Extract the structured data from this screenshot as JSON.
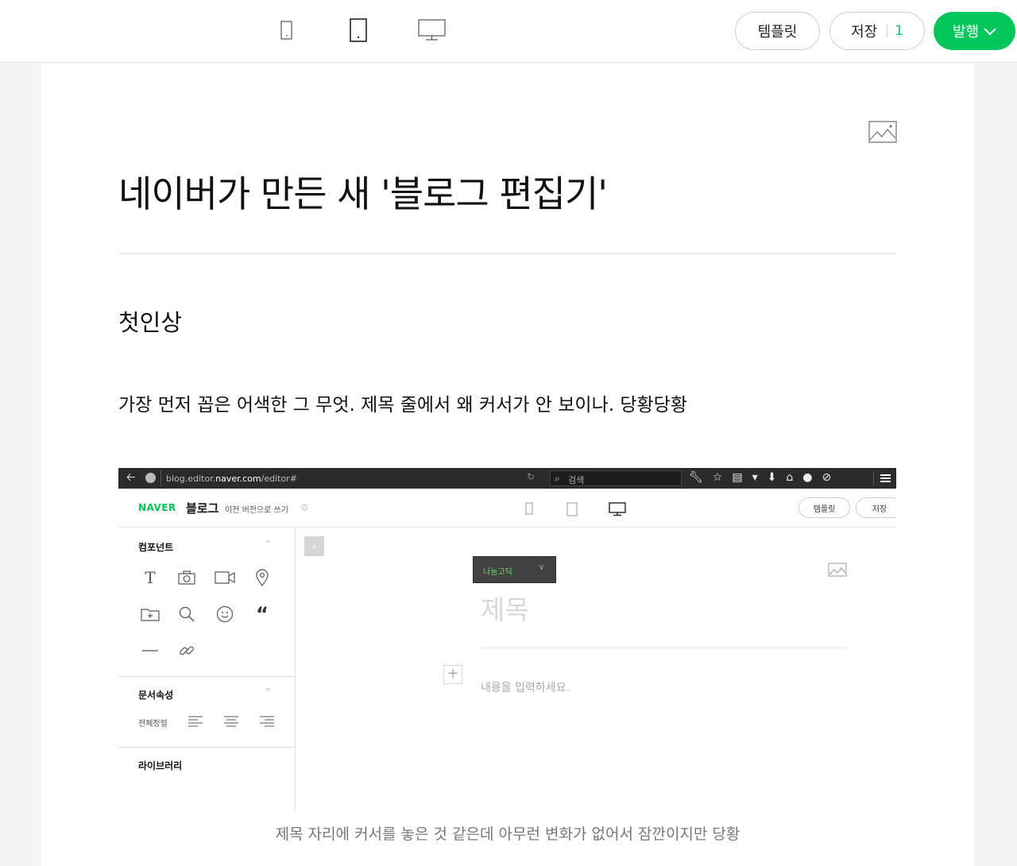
{
  "topbar": {
    "device_buttons": [
      "mobile",
      "tablet",
      "desktop"
    ],
    "template_label": "템플릿",
    "save_label": "저장",
    "save_count": "1",
    "publish_label": "발행",
    "accent_color": "#03c75a"
  },
  "post": {
    "title": "네이버가 만든 새 '블로그 편집기'",
    "heading": "첫인상",
    "paragraph": "가장 먼저 꼽은 어색한 그 무엇. 제목 줄에서 왜 커서가 안 보이나. 당황당황",
    "caption": "제목 자리에 커서를 놓은 것 같은데 아무런 변화가 없어서 잠깐이지만 당황"
  },
  "screenshot": {
    "browser": {
      "url_prefix": "blog.editor.",
      "url_domain": "naver.com",
      "url_path": "/editor#",
      "search_placeholder": "검색"
    },
    "header": {
      "logo": "NAVER",
      "blog": "블로그",
      "prev_version": "이전 버전으로 쓰기",
      "template_label": "템플릿",
      "save_label": "저장"
    },
    "sidebar": {
      "components_label": "컴포넌트",
      "doc_props_label": "문서속성",
      "align_label": "전체정렬",
      "library_label": "라이브러리"
    },
    "editor": {
      "font_name": "나눔고딕",
      "title_placeholder": "제목",
      "body_placeholder": "내용을 입력하세요."
    }
  }
}
